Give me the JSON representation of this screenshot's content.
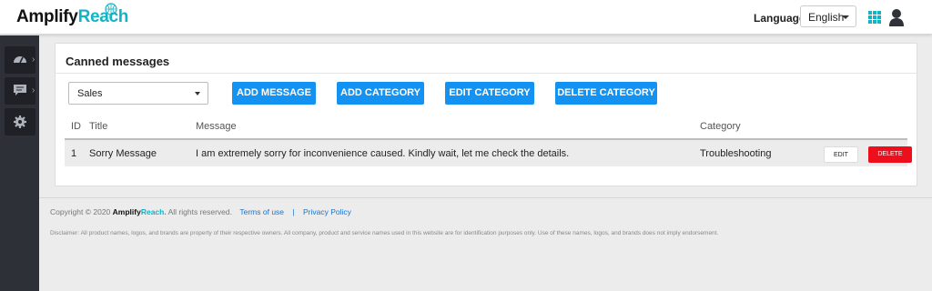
{
  "header": {
    "logo_prefix": "Amplify",
    "logo_accent": "Reach",
    "language_label": "Language",
    "language_value": "English"
  },
  "sidebar": {
    "items": [
      {
        "icon": "dashboard-icon"
      },
      {
        "icon": "chat-icon"
      },
      {
        "icon": "gear-icon"
      }
    ]
  },
  "card": {
    "title": "Canned messages",
    "category_select": "Sales",
    "buttons": {
      "add_message": "ADD MESSAGE",
      "add_category": "ADD CATEGORY",
      "edit_category": "EDIT CATEGORY",
      "delete_category": "DELETE CATEGORY"
    },
    "table": {
      "headers": [
        "ID",
        "Title",
        "Message",
        "Category"
      ],
      "rows": [
        {
          "id": "1",
          "title": "Sorry Message",
          "message": "I am extremely sorry for inconvenience caused. Kindly wait, let me check the details.",
          "category": "Troubleshooting",
          "edit_label": "EDIT",
          "delete_label": "DELETE"
        }
      ]
    }
  },
  "footer": {
    "copyright_prefix": "Copyright © 2020",
    "brand_prefix": "Amplify",
    "brand_accent": "Reach.",
    "rights": "All rights reserved.",
    "terms_link": "Terms of use",
    "separator": "|",
    "privacy_link": "Privacy Policy",
    "disclaimer": "Disclaimer: All product names, logos, and brands are property of their respective owners. All company, product and service names used in this website are for identification purposes only. Use of these names, logos, and brands does not imply endorsement."
  },
  "colors": {
    "accent": "#12b3c4",
    "primary_button": "#1392f2",
    "delete_button": "#ee0f1c",
    "sidebar": "#2d3037"
  }
}
